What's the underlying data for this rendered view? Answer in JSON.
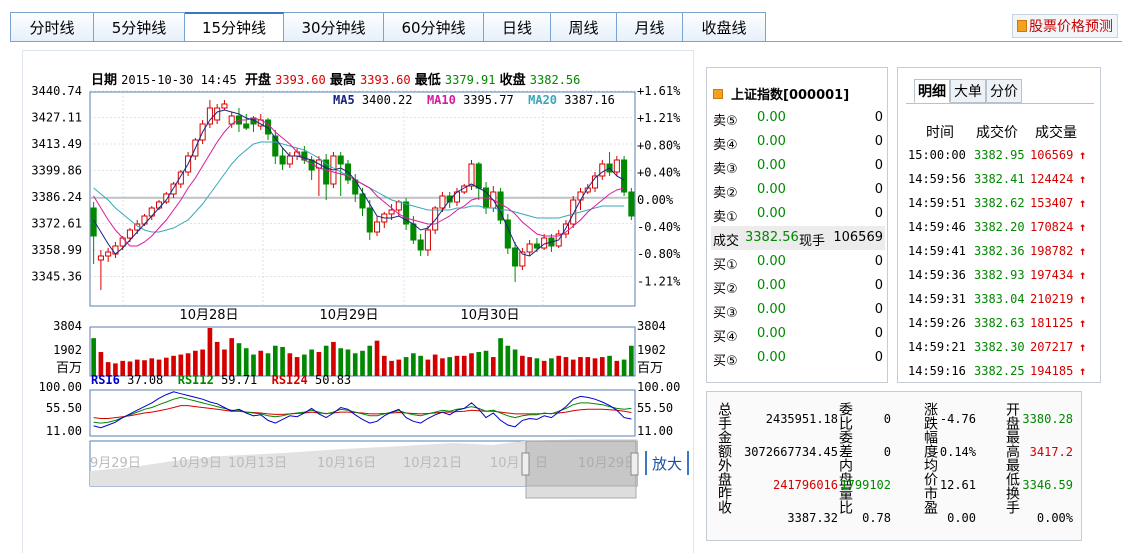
{
  "tabs": [
    {
      "label": "分时线",
      "w": 84
    },
    {
      "label": "5分钟线",
      "w": 91
    },
    {
      "label": "15分钟线",
      "w": 99
    },
    {
      "label": "30分钟线",
      "w": 100
    },
    {
      "label": "60分钟线",
      "w": 100
    },
    {
      "label": "日线",
      "w": 67
    },
    {
      "label": "周线",
      "w": 66
    },
    {
      "label": "月线",
      "w": 66
    },
    {
      "label": "收盘线",
      "w": 83
    }
  ],
  "active_tab": 2,
  "predict_label": "股票价格预测",
  "header": {
    "date_label": "日期",
    "date": "2015-10-30 14:45",
    "open_label": "开盘",
    "open": "3393.60",
    "high_label": "最高",
    "high": "3393.60",
    "low_label": "最低",
    "low": "3379.91",
    "close_label": "收盘",
    "close": "3382.56"
  },
  "ma": {
    "ma5_label": "MA5",
    "ma5": "3400.22",
    "ma10_label": "MA10",
    "ma10": "3395.77",
    "ma20_label": "MA20",
    "ma20": "3387.16"
  },
  "colors": {
    "up": "#d40000",
    "down": "#008800",
    "ma5": "#1a237e",
    "ma10": "#d81b9c",
    "ma20": "#3aa7b5",
    "grid": "#bcd",
    "axis": "#5a7fb0"
  },
  "chart_data": {
    "type": "candlestick",
    "y_ticks": [
      "3440.74",
      "3427.11",
      "3413.49",
      "3399.86",
      "3386.24",
      "3372.61",
      "3358.99",
      "3345.36"
    ],
    "pct_ticks": [
      "+1.61%",
      "+1.21%",
      "+0.80%",
      "+0.40%",
      "0.00%",
      "-0.40%",
      "-0.80%",
      "-1.21%"
    ],
    "ylim": [
      3337,
      3444
    ],
    "x_labels": [
      "10月28日",
      "10月29日",
      "10月30日"
    ],
    "candles": [
      [
        3386,
        3372,
        3389,
        3358
      ],
      [
        3360,
        3362,
        3365,
        3345
      ],
      [
        3362,
        3364,
        3366,
        3359
      ],
      [
        3363,
        3367,
        3369,
        3361
      ],
      [
        3367,
        3371,
        3372,
        3365
      ],
      [
        3371,
        3375,
        3376,
        3369
      ],
      [
        3375,
        3378,
        3380,
        3373
      ],
      [
        3378,
        3382,
        3383,
        3377
      ],
      [
        3382,
        3386,
        3387,
        3380
      ],
      [
        3386,
        3389,
        3390,
        3385
      ],
      [
        3389,
        3393,
        3394,
        3388
      ],
      [
        3393,
        3398,
        3399,
        3391
      ],
      [
        3398,
        3404,
        3405,
        3396
      ],
      [
        3404,
        3412,
        3414,
        3402
      ],
      [
        3412,
        3420,
        3421,
        3410
      ],
      [
        3420,
        3428,
        3430,
        3418
      ],
      [
        3428,
        3436,
        3440,
        3426
      ],
      [
        3430,
        3436,
        3438,
        3428
      ],
      [
        3436,
        3438,
        3440,
        3435
      ],
      [
        3428,
        3432,
        3434,
        3426
      ],
      [
        3432,
        3428,
        3436,
        3424
      ],
      [
        3428,
        3426,
        3433,
        3425
      ],
      [
        3431,
        3428,
        3432,
        3424
      ],
      [
        3427,
        3430,
        3433,
        3425
      ],
      [
        3430,
        3423,
        3431,
        3420
      ],
      [
        3422,
        3412,
        3425,
        3408
      ],
      [
        3412,
        3408,
        3416,
        3405
      ],
      [
        3408,
        3412,
        3414,
        3406
      ],
      [
        3412,
        3414,
        3416,
        3410
      ],
      [
        3414,
        3410,
        3417,
        3408
      ],
      [
        3410,
        3405,
        3412,
        3400
      ],
      [
        3406,
        3410,
        3412,
        3392
      ],
      [
        3410,
        3398,
        3413,
        3390
      ],
      [
        3398,
        3412,
        3414,
        3396
      ],
      [
        3412,
        3408,
        3414,
        3392
      ],
      [
        3408,
        3400,
        3410,
        3398
      ],
      [
        3400,
        3393,
        3403,
        3389
      ],
      [
        3393,
        3386,
        3396,
        3382
      ],
      [
        3386,
        3374,
        3390,
        3370
      ],
      [
        3374,
        3379,
        3382,
        3372
      ],
      [
        3379,
        3383,
        3384,
        3376
      ],
      [
        3383,
        3385,
        3388,
        3380
      ],
      [
        3385,
        3389,
        3390,
        3382
      ],
      [
        3389,
        3378,
        3391,
        3375
      ],
      [
        3378,
        3370,
        3382,
        3368
      ],
      [
        3370,
        3365,
        3373,
        3362
      ],
      [
        3365,
        3375,
        3377,
        3362
      ],
      [
        3375,
        3386,
        3387,
        3373
      ],
      [
        3386,
        3392,
        3394,
        3384
      ],
      [
        3392,
        3389,
        3394,
        3386
      ],
      [
        3389,
        3394,
        3396,
        3387
      ],
      [
        3394,
        3397,
        3398,
        3393
      ],
      [
        3397,
        3408,
        3410,
        3395
      ],
      [
        3408,
        3396,
        3409,
        3390
      ],
      [
        3396,
        3386,
        3399,
        3383
      ],
      [
        3386,
        3394,
        3397,
        3384
      ],
      [
        3394,
        3380,
        3396,
        3378
      ],
      [
        3380,
        3366,
        3383,
        3363
      ],
      [
        3366,
        3357,
        3369,
        3349
      ],
      [
        3357,
        3364,
        3366,
        3355
      ],
      [
        3364,
        3368,
        3370,
        3362
      ],
      [
        3368,
        3366,
        3371,
        3364
      ],
      [
        3366,
        3371,
        3373,
        3365
      ],
      [
        3371,
        3367,
        3373,
        3364
      ],
      [
        3367,
        3373,
        3375,
        3366
      ],
      [
        3373,
        3378,
        3380,
        3371
      ],
      [
        3378,
        3390,
        3392,
        3376
      ],
      [
        3390,
        3394,
        3396,
        3385
      ],
      [
        3394,
        3396,
        3398,
        3393
      ],
      [
        3396,
        3402,
        3404,
        3394
      ],
      [
        3402,
        3408,
        3410,
        3400
      ],
      [
        3408,
        3404,
        3414,
        3402
      ],
      [
        3404,
        3410,
        3412,
        3402
      ],
      [
        3410,
        3394,
        3412,
        3392
      ],
      [
        3394,
        3382,
        3396,
        3380
      ]
    ],
    "ma5": [
      3380,
      3374,
      3368,
      3363,
      3366,
      3370,
      3374,
      3378,
      3382,
      3386,
      3390,
      3396,
      3402,
      3408,
      3416,
      3424,
      3430,
      3434,
      3435,
      3434,
      3433,
      3431,
      3430,
      3428,
      3426,
      3421,
      3416,
      3412,
      3412,
      3411,
      3410,
      3408,
      3406,
      3405,
      3406,
      3404,
      3400,
      3394,
      3388,
      3382,
      3381,
      3381,
      3382,
      3380,
      3378,
      3375,
      3376,
      3380,
      3385,
      3390,
      3394,
      3396,
      3398,
      3396,
      3394,
      3390,
      3384,
      3376,
      3368,
      3363,
      3362,
      3365,
      3368,
      3369,
      3370,
      3376,
      3383,
      3390,
      3396,
      3401,
      3404,
      3406,
      3402,
      3400
    ],
    "ma10": [
      3392,
      3386,
      3380,
      3375,
      3371,
      3367,
      3367,
      3369,
      3372,
      3376,
      3380,
      3385,
      3390,
      3396,
      3401,
      3407,
      3413,
      3419,
      3424,
      3428,
      3430,
      3430,
      3431,
      3430,
      3428,
      3424,
      3421,
      3418,
      3414,
      3410,
      3408,
      3406,
      3405,
      3404,
      3403,
      3402,
      3400,
      3398,
      3396,
      3392,
      3389,
      3386,
      3383,
      3381,
      3380,
      3379,
      3378,
      3378,
      3380,
      3382,
      3385,
      3387,
      3390,
      3391,
      3391,
      3390,
      3388,
      3386,
      3383,
      3379,
      3376,
      3373,
      3372,
      3372,
      3372,
      3374,
      3377,
      3380,
      3384,
      3387,
      3390,
      3393,
      3395,
      3396
    ],
    "ma20": [
      3396,
      3393,
      3390,
      3386,
      3383,
      3380,
      3377,
      3375,
      3374,
      3374,
      3375,
      3376,
      3378,
      3380,
      3384,
      3388,
      3393,
      3398,
      3403,
      3408,
      3412,
      3415,
      3418,
      3419,
      3419,
      3419,
      3418,
      3417,
      3416,
      3415,
      3413,
      3411,
      3408,
      3406,
      3404,
      3402,
      3400,
      3398,
      3396,
      3394,
      3392,
      3390,
      3389,
      3388,
      3387,
      3386,
      3385,
      3385,
      3385,
      3385,
      3386,
      3386,
      3387,
      3387,
      3386,
      3386,
      3385,
      3385,
      3384,
      3383,
      3382,
      3381,
      3381,
      3381,
      3381,
      3382,
      3383,
      3384,
      3385,
      3386,
      3387,
      3387,
      3387,
      3387
    ],
    "volume_ticks": [
      "3804",
      "1902"
    ],
    "volume_unit": "百万",
    "volume_max": 3804,
    "volume": [
      3000,
      1900,
      1100,
      1000,
      1200,
      1150,
      1300,
      1250,
      1400,
      1300,
      1450,
      1600,
      1700,
      1800,
      2000,
      2100,
      3804,
      2700,
      2100,
      3000,
      2600,
      2200,
      1700,
      2000,
      1800,
      2400,
      2300,
      1800,
      1500,
      1700,
      2100,
      1900,
      2400,
      2700,
      2200,
      2100,
      1800,
      2000,
      2400,
      2800,
      1600,
      1200,
      1300,
      1500,
      1800,
      1600,
      1300,
      1700,
      1400,
      1500,
      1600,
      1600,
      1800,
      1900,
      2000,
      1500,
      3000,
      2400,
      2100,
      1600,
      1500,
      1400,
      1200,
      1400,
      1600,
      1500,
      1300,
      1500,
      1500,
      1400,
      1500,
      1600,
      1200,
      1300,
      2400
    ],
    "rsi_labels": {
      "rsi6_label": "RSI6",
      "rsi6": "37.08",
      "rsi12_label": "RSI12",
      "rsi12": "59.71",
      "rsi24_label": "RSI24",
      "rsi24": "50.83"
    },
    "rsi_ticks": [
      "100.00",
      "55.50",
      "11.00"
    ],
    "rsi6": [
      22,
      18,
      24,
      30,
      40,
      48,
      56,
      64,
      72,
      82,
      90,
      96,
      92,
      88,
      84,
      80,
      74,
      70,
      62,
      54,
      58,
      50,
      44,
      46,
      34,
      28,
      36,
      44,
      42,
      50,
      60,
      48,
      40,
      50,
      62,
      58,
      46,
      36,
      28,
      32,
      44,
      52,
      58,
      40,
      32,
      28,
      38,
      46,
      52,
      46,
      56,
      60,
      72,
      58,
      40,
      50,
      34,
      24,
      20,
      34,
      38,
      36,
      44,
      40,
      52,
      64,
      80,
      86,
      84,
      80,
      74,
      66,
      56,
      40,
      37
    ],
    "rsi12": [
      30,
      28,
      30,
      34,
      40,
      46,
      52,
      58,
      62,
      68,
      74,
      80,
      84,
      80,
      76,
      72,
      68,
      64,
      60,
      56,
      56,
      52,
      50,
      48,
      44,
      42,
      44,
      48,
      50,
      52,
      56,
      52,
      48,
      52,
      58,
      56,
      52,
      48,
      44,
      44,
      48,
      52,
      55,
      50,
      46,
      44,
      48,
      52,
      56,
      54,
      58,
      60,
      64,
      60,
      54,
      56,
      50,
      44,
      40,
      44,
      46,
      46,
      50,
      48,
      54,
      60,
      68,
      72,
      72,
      70,
      68,
      64,
      60,
      58,
      60
    ],
    "rsi24": [
      40,
      38,
      38,
      40,
      42,
      44,
      47,
      50,
      52,
      55,
      58,
      62,
      66,
      66,
      64,
      62,
      60,
      58,
      56,
      54,
      54,
      52,
      51,
      50,
      48,
      47,
      47,
      48,
      49,
      50,
      52,
      50,
      49,
      50,
      52,
      52,
      51,
      50,
      48,
      48,
      49,
      50,
      51,
      50,
      49,
      48,
      49,
      50,
      52,
      52,
      53,
      54,
      56,
      55,
      54,
      54,
      52,
      50,
      48,
      48,
      48,
      48,
      49,
      49,
      50,
      52,
      55,
      57,
      58,
      58,
      58,
      57,
      56,
      54,
      51
    ]
  },
  "navigator": {
    "labels": [
      "9月29日",
      "10月9日",
      "10月13日",
      "10月16日",
      "10月21日",
      "10月",
      "日",
      "10月29日"
    ],
    "zoom_label": "放大"
  },
  "market": {
    "title": "上证指数[000001]",
    "asks": [
      {
        "label": "卖⑤",
        "price": "0.00",
        "vol": "0"
      },
      {
        "label": "卖④",
        "price": "0.00",
        "vol": "0"
      },
      {
        "label": "卖③",
        "price": "0.00",
        "vol": "0"
      },
      {
        "label": "卖②",
        "price": "0.00",
        "vol": "0"
      },
      {
        "label": "卖①",
        "price": "0.00",
        "vol": "0"
      }
    ],
    "trade": {
      "label": "成交",
      "price": "3382.56",
      "now_label": "现手",
      "vol": "106569"
    },
    "bids": [
      {
        "label": "买①",
        "price": "0.00",
        "vol": "0"
      },
      {
        "label": "买②",
        "price": "0.00",
        "vol": "0"
      },
      {
        "label": "买③",
        "price": "0.00",
        "vol": "0"
      },
      {
        "label": "买④",
        "price": "0.00",
        "vol": "0"
      },
      {
        "label": "买⑤",
        "price": "0.00",
        "vol": "0"
      }
    ]
  },
  "ticks": {
    "tabs": [
      "明细",
      "大单",
      "分价"
    ],
    "headers": [
      "时间",
      "成交价",
      "成交量"
    ],
    "rows": [
      {
        "time": "15:00:00",
        "price": "3382.95",
        "vol": "106569"
      },
      {
        "time": "14:59:56",
        "price": "3382.41",
        "vol": "124424"
      },
      {
        "time": "14:59:51",
        "price": "3382.62",
        "vol": "153407"
      },
      {
        "time": "14:59:46",
        "price": "3382.20",
        "vol": "170824"
      },
      {
        "time": "14:59:41",
        "price": "3382.36",
        "vol": "198782"
      },
      {
        "time": "14:59:36",
        "price": "3382.93",
        "vol": "197434"
      },
      {
        "time": "14:59:31",
        "price": "3383.04",
        "vol": "210219"
      },
      {
        "time": "14:59:26",
        "price": "3382.63",
        "vol": "181125"
      },
      {
        "time": "14:59:21",
        "price": "3382.30",
        "vol": "207217"
      },
      {
        "time": "14:59:16",
        "price": "3382.25",
        "vol": "194185"
      }
    ]
  },
  "stats": {
    "col1_labels": "总手金额外盘昨收",
    "col1_values": [
      "2435951.18",
      "3072667734.45",
      "241796016",
      "3387.32"
    ],
    "col2_labels": "委比委差内盘量比",
    "col2_values": [
      "0",
      "0",
      "1799102",
      "0.78"
    ],
    "col3_labels": "涨跌幅度均价市盈",
    "col3_values": [
      "-4.76",
      "-0.14%",
      "12.61",
      "0.00"
    ],
    "col4_labels": "开盘最高最低换手",
    "col4_values": [
      "3380.28",
      "3417.2",
      "3346.59",
      "0.00%"
    ]
  }
}
